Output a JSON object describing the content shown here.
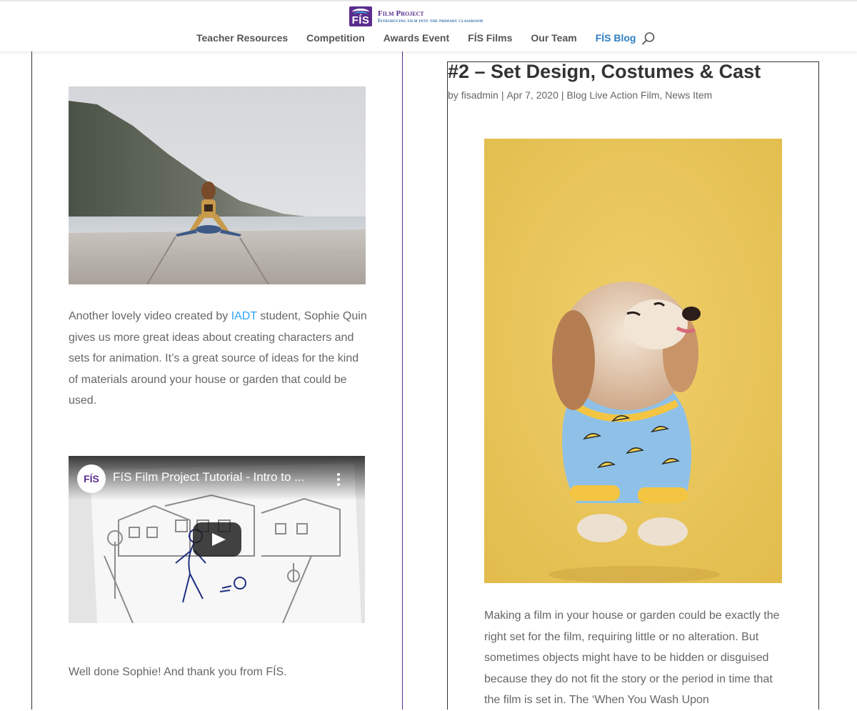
{
  "header": {
    "logo_badge": "FÍS",
    "logo_title": "Film Project",
    "logo_tagline": "Introducing film into the primary classroom",
    "nav": [
      {
        "label": "Teacher Resources"
      },
      {
        "label": "Competition"
      },
      {
        "label": "Awards Event"
      },
      {
        "label": "FÍS Films"
      },
      {
        "label": "Our Team"
      },
      {
        "label": "FÍS Blog",
        "active": true
      }
    ],
    "search_icon": "search-icon"
  },
  "left_post": {
    "image_icon": "photo-toy-on-pier",
    "paragraph_before_link": "Another lovely video created by ",
    "link_text": "IADT",
    "paragraph_after_link": " student, Sophie Quin gives us more great ideas about creating characters and sets for animation.  It’s a great source of ideas for the kind of materials around your house or garden that could be used.",
    "video": {
      "channel_avatar": "FÍS",
      "title": "FíS Film Project Tutorial - Intro to ...",
      "play_icon": "play-icon",
      "menu_icon": "more-vertical-icon"
    },
    "thanks": "Well done Sophie! And thank you from FÍS."
  },
  "right_post": {
    "title": "#2 – Set Design, Costumes & Cast",
    "meta": {
      "by_prefix": "by ",
      "author": "fisadmin",
      "date": "Apr 7, 2020",
      "categories": "Blog Live Action Film, News Item"
    },
    "image_icon": "photo-dog-in-pyjamas",
    "paragraph": "Making a film in your house or garden could be exactly the right set for the film, requiring little or no alteration.  But sometimes objects might have to be hidden or disguised because they do not fit the story or the period in time that the film is set in.  The ‘When You Wash Upon"
  },
  "colors": {
    "brand_purple": "#5b2d8e",
    "link_blue": "#2ea3f2",
    "nav_active": "#2f7fc1",
    "body_text": "#666666",
    "heading_text": "#333333"
  }
}
